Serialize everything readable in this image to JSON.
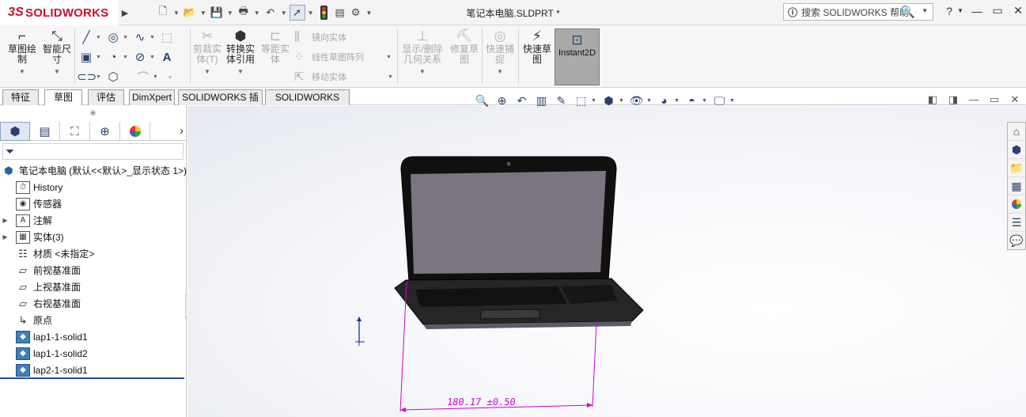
{
  "app": {
    "brand_prefix": "3S",
    "brand": "SOLIDWORKS",
    "document_title": "笔记本电脑.SLDPRT *"
  },
  "search": {
    "placeholder": "搜索 SOLIDWORKS 帮助"
  },
  "title_bar_right": {
    "help": "?",
    "minimize": "—",
    "restore": "▭",
    "close": "✕"
  },
  "quick_access": [
    {
      "icon": "new-document-icon"
    },
    {
      "icon": "open-folder-icon"
    },
    {
      "icon": "save-icon"
    },
    {
      "icon": "print-icon"
    },
    {
      "icon": "undo-icon"
    },
    {
      "icon": "select-cursor-icon"
    },
    {
      "icon": "rebuild-traffic-light-icon"
    },
    {
      "icon": "file-properties-icon"
    },
    {
      "icon": "options-gear-icon"
    }
  ],
  "command_manager": {
    "sketch": "草图绘\n制",
    "smart_dimension": "智能尺\n寸",
    "trim": "剪裁实\n体(T)",
    "convert": "转换实\n体引用",
    "offset": "等距实\n体",
    "mirror": "镜向实体",
    "linear_pattern": "线性草图阵列",
    "move": "移动实体",
    "display_relations": "显示/删除\n几何关系",
    "repair": "修复草\n图",
    "quick_snap": "快速捕\n捉",
    "rapid_sketch": "快速草\n图",
    "instant2d": "Instant2D"
  },
  "tabs": [
    {
      "label": "特征",
      "active": false
    },
    {
      "label": "草图",
      "active": true
    },
    {
      "label": "评估",
      "active": false
    },
    {
      "label": "DimXpert",
      "active": false
    },
    {
      "label": "SOLIDWORKS 插件",
      "active": false
    },
    {
      "label": "SOLIDWORKS MBD",
      "active": false
    }
  ],
  "feature_tree": {
    "root": "笔记本电脑 (默认<<默认>_显示状态 1>)",
    "items": [
      {
        "label": "History",
        "icon": "history-icon",
        "expandable": false
      },
      {
        "label": "传感器",
        "icon": "sensor-icon",
        "expandable": false
      },
      {
        "label": "注解",
        "icon": "annotation-icon",
        "expandable": true
      },
      {
        "label": "实体(3)",
        "icon": "solid-bodies-icon",
        "expandable": true
      },
      {
        "label": "材质 <未指定>",
        "icon": "material-icon",
        "expandable": false
      },
      {
        "label": "前视基准面",
        "icon": "plane-icon",
        "expandable": false
      },
      {
        "label": "上视基准面",
        "icon": "plane-icon",
        "expandable": false
      },
      {
        "label": "右视基准面",
        "icon": "plane-icon",
        "expandable": false
      },
      {
        "label": "原点",
        "icon": "origin-icon",
        "expandable": false
      },
      {
        "label": "lap1-1-solid1",
        "icon": "solid-body-icon",
        "expandable": false
      },
      {
        "label": "lap1-1-solid2",
        "icon": "solid-body-icon",
        "expandable": false
      },
      {
        "label": "lap2-1-solid1",
        "icon": "solid-body-icon",
        "expandable": false
      }
    ]
  },
  "viewport": {
    "dimension_text": "180.17 ±0.50",
    "dimension_color": "#d400d4"
  },
  "colors": {
    "brand": "#c8102e",
    "selected_tab_blue": "#234d8f",
    "instant2d_active": "#a9a9a9"
  }
}
